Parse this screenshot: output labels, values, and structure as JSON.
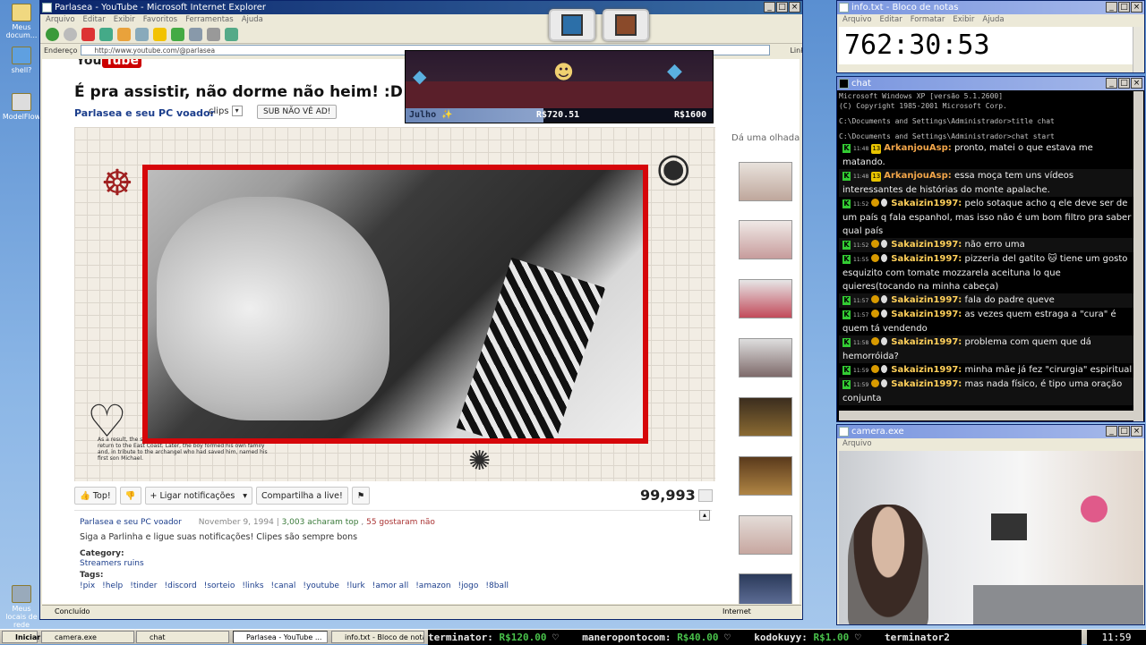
{
  "desktop": {
    "icons": [
      "Meus docum...",
      "shell?",
      "ModelFlow",
      "Meus locais de rede"
    ]
  },
  "ie": {
    "title": "Parlasea - YouTube - Microsoft Internet Explorer",
    "menu": [
      "Arquivo",
      "Editar",
      "Exibir",
      "Favoritos",
      "Ferramentas",
      "Ajuda"
    ],
    "address_label": "Endereço",
    "address": "http://www.youtube.com/@parlasea",
    "links_label": "Links",
    "status": "Concluído",
    "zone": "Internet"
  },
  "youtube": {
    "logo_you": "You",
    "logo_tube": "Tube",
    "video_title": "É pra assistir, não dorme não heim! :D",
    "channel": "Parlasea e seu PC voador",
    "clips_label": "clips",
    "subscribe_label": "SUB NÃO VÊ AD!",
    "sidebar_label": "Dá uma olhada",
    "like_label": "Top!",
    "notify_label": "Ligar notificações",
    "share_label": "Compartilha a live!",
    "views": "99,993",
    "desc": {
      "author": "Parlasea e seu PC voador",
      "date": "November 9, 1994",
      "likes": "3,003 acharam top",
      "dislikes": "55 gostaram não",
      "text": "Siga a Parlinha e ligue suas notificações! Clipes são sempre bons",
      "category_label": "Category:",
      "category": "Streamers ruins",
      "tags_label": "Tags:",
      "tags": [
        "!pix",
        "!help",
        "!tinder",
        "!discord",
        "!sorteio",
        "!links",
        "!canal",
        "!youtube",
        "!lurk",
        "!amor all",
        "!amazon",
        "!jogo",
        "!8ball"
      ]
    },
    "player_caption": "As a result, the sources, after the ... from public attention and return to the East Coast. Later, the boy formed his own family and, in tribute to the archangel who had saved him, named his first son Michael."
  },
  "game": {
    "month": "Julho",
    "current": "R$720.51",
    "goal": "R$1600",
    "progress": 0.45
  },
  "notepad": {
    "title": "info.txt - Bloco de notas",
    "menu": [
      "Arquivo",
      "Editar",
      "Formatar",
      "Exibir",
      "Ajuda"
    ],
    "text": "762:30:53"
  },
  "chat": {
    "title": "chat",
    "header": [
      "Microsoft Windows XP [versão 5.1.2600]",
      "(C) Copyright 1985-2001 Microsoft Corp.",
      "",
      "C:\\Documents and Settings\\Administrador>title chat",
      "",
      "C:\\Documents and Settings\\Administrador>chat start"
    ],
    "messages": [
      {
        "time": "11:48",
        "badge": "13",
        "user": "ArkanjouAsp:",
        "text": "pronto, matei o que estava me matando.",
        "style": "u1"
      },
      {
        "time": "11:48",
        "badge": "13",
        "user": "ArkanjouAsp:",
        "text": "essa moça tem uns vídeos interessantes de histórias do monte apalache.",
        "style": "u1"
      },
      {
        "time": "11:52",
        "badge": "",
        "user": "Sakaizin1997:",
        "text": "pelo sotaque acho q ele deve ser de um país q fala espanhol, mas isso não é um bom filtro pra saber qual país",
        "style": "u2"
      },
      {
        "time": "11:52",
        "badge": "",
        "user": "Sakaizin1997:",
        "text": "não erro uma",
        "style": "u2"
      },
      {
        "time": "11:55",
        "badge": "",
        "user": "Sakaizin1997:",
        "text": "pizzeria del gatito 🐱 tiene um gosto esquizito com tomate mozzarela aceituna lo que quieres(tocando na minha cabeça)",
        "style": "u2"
      },
      {
        "time": "11:57",
        "badge": "",
        "user": "Sakaizin1997:",
        "text": "fala do padre queve",
        "style": "u2"
      },
      {
        "time": "11:57",
        "badge": "",
        "user": "Sakaizin1997:",
        "text": "as vezes quem estraga a \"cura\" é quem tá vendendo",
        "style": "u2"
      },
      {
        "time": "11:58",
        "badge": "",
        "user": "Sakaizin1997:",
        "text": "problema com quem que dá hemorróida?",
        "style": "u2"
      },
      {
        "time": "11:59",
        "badge": "",
        "user": "Sakaizin1997:",
        "text": "minha mãe já fez \"cirurgia\" espiritual",
        "style": "u2"
      },
      {
        "time": "11:59",
        "badge": "",
        "user": "Sakaizin1997:",
        "text": "mas nada físico, é tipo uma oração conjunta",
        "style": "u2"
      }
    ]
  },
  "camera": {
    "title": "camera.exe",
    "menu": [
      "Arquivo"
    ]
  },
  "taskbar": {
    "start": "Iniciar",
    "tasks": [
      "camera.exe",
      "chat",
      "Parlasea - YouTube ...",
      "info.txt - Bloco de notas"
    ],
    "ticker": [
      {
        "name": "terminator:",
        "amount": "R$120.00"
      },
      {
        "name": "maneropontocom:",
        "amount": "R$40.00"
      },
      {
        "name": "kodokuyy:",
        "amount": "R$1.00"
      },
      {
        "name": "terminator2",
        "amount": ""
      }
    ],
    "clock": "11:59"
  }
}
